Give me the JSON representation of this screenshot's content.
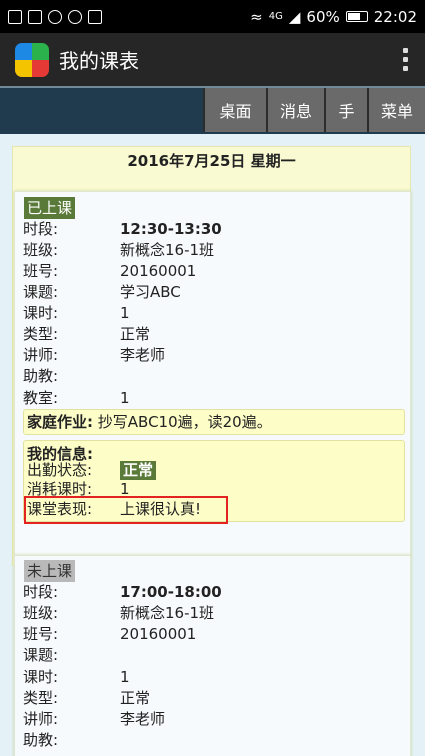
{
  "status_bar": {
    "network_label_top": "4G",
    "battery": "60%",
    "time": "22:02"
  },
  "app": {
    "title": "我的课表"
  },
  "toolbar": {
    "buttons": [
      "桌面",
      "消息",
      "手",
      "菜单"
    ]
  },
  "date_header": "2016年7月25日 星期一",
  "lessons": [
    {
      "status": "已上课",
      "fields": [
        {
          "label": "时段:",
          "value": "12:30-13:30"
        },
        {
          "label": "班级:",
          "value": "新概念16-1班"
        },
        {
          "label": "班号:",
          "value": "20160001"
        },
        {
          "label": "课题:",
          "value": "学习ABC"
        },
        {
          "label": "课时:",
          "value": "1"
        },
        {
          "label": "类型:",
          "value": "正常"
        },
        {
          "label": "讲师:",
          "value": "李老师"
        },
        {
          "label": "助教:",
          "value": ""
        },
        {
          "label": "教室:",
          "value": "1"
        }
      ],
      "homework_label": "家庭作业:",
      "homework_value": "抄写ABC10遍，读20遍。",
      "my_info": {
        "title": "我的信息:",
        "attendance_label": "出勤状态:",
        "attendance_value": "正常",
        "consumed_label": "消耗课时:",
        "consumed_value": "1",
        "performance_label": "课堂表现:",
        "performance_value": "上课很认真!"
      }
    },
    {
      "status": "未上课",
      "fields": [
        {
          "label": "时段:",
          "value": "17:00-18:00"
        },
        {
          "label": "班级:",
          "value": "新概念16-1班"
        },
        {
          "label": "班号:",
          "value": "20160001"
        },
        {
          "label": "课题:",
          "value": ""
        },
        {
          "label": "课时:",
          "value": "1"
        },
        {
          "label": "类型:",
          "value": "正常"
        },
        {
          "label": "讲师:",
          "value": "李老师"
        },
        {
          "label": "助教:",
          "value": ""
        }
      ]
    }
  ]
}
